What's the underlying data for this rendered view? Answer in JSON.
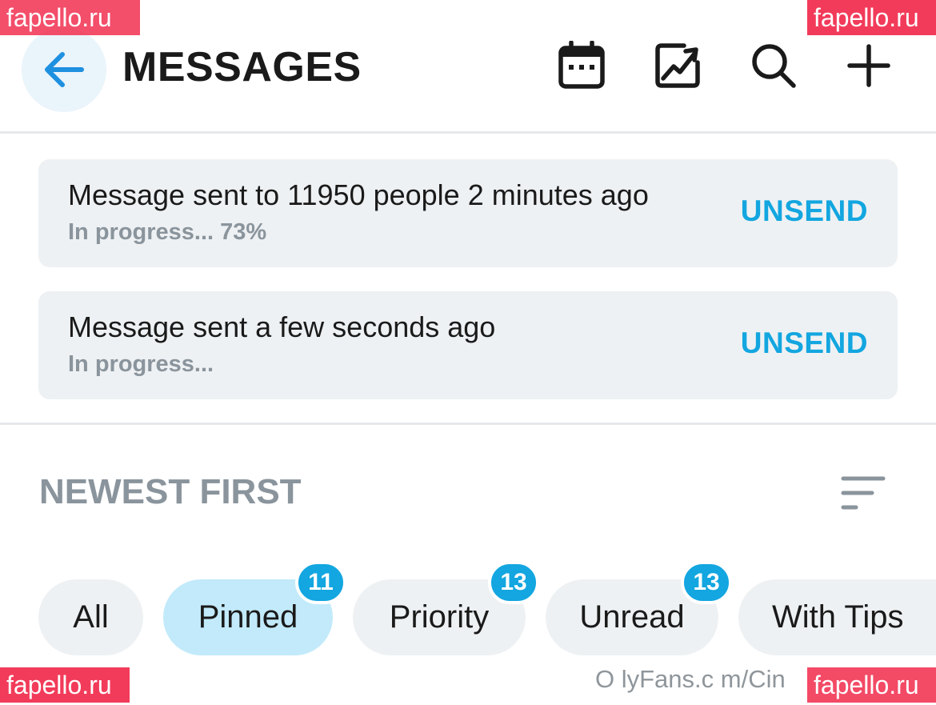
{
  "header": {
    "title": "MESSAGES",
    "back_icon": "arrow-left-icon",
    "actions": [
      {
        "icon": "calendar-icon"
      },
      {
        "icon": "image-chart-icon"
      },
      {
        "icon": "search-icon"
      },
      {
        "icon": "plus-icon"
      }
    ]
  },
  "queue": [
    {
      "text": "Message sent to 11950 people 2 minutes ago",
      "status": "In progress... 73%",
      "progress_percent": 73,
      "action": "UNSEND"
    },
    {
      "text": "Message sent a few seconds ago",
      "status": "In progress...",
      "action": "UNSEND"
    }
  ],
  "sort": {
    "label": "NEWEST FIRST",
    "icon": "sort-lines-icon"
  },
  "filters": [
    {
      "label": "All"
    },
    {
      "label": "Pinned",
      "badge": "11",
      "active": true
    },
    {
      "label": "Priority",
      "badge": "13"
    },
    {
      "label": "Unread",
      "badge": "13"
    },
    {
      "label": "With Tips"
    }
  ],
  "watermarks": {
    "top_left": "fapello.ru",
    "top_right": "fapello.ru",
    "bottom_left": "fapello.ru",
    "bottom_right": "fapello.ru"
  },
  "footer_url": "O lyFans.c m/Cin",
  "colors": {
    "accent": "#13a6e0",
    "active_chip": "#c2eafa",
    "card_bg": "#eef1f3",
    "muted_text": "#8a949c",
    "watermark": "#f23b5a"
  }
}
